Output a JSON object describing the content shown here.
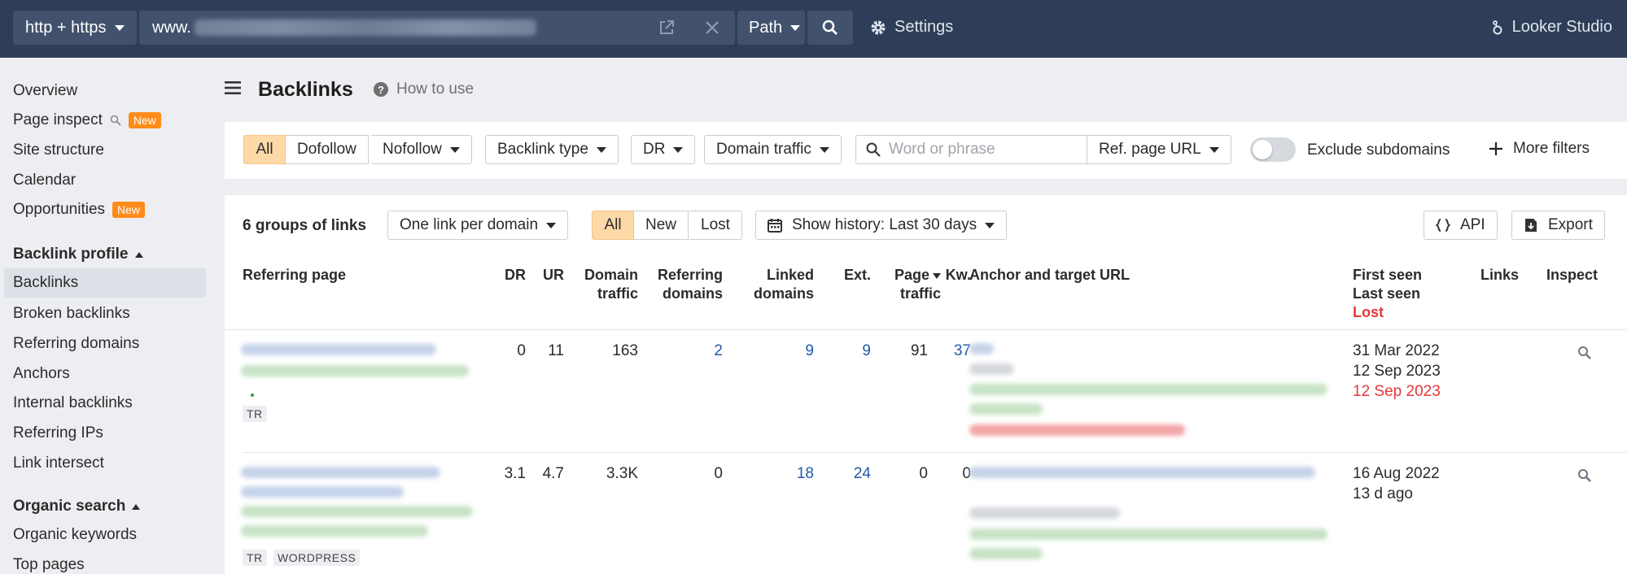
{
  "topbar": {
    "protocol": "http + https",
    "url_prefix": "www.",
    "path_label": "Path",
    "settings_label": "Settings",
    "looker_label": "Looker Studio"
  },
  "sidebar": {
    "items": [
      {
        "label": "Overview"
      },
      {
        "label": "Page inspect",
        "badge": "New"
      },
      {
        "label": "Site structure"
      },
      {
        "label": "Calendar"
      },
      {
        "label": "Opportunities",
        "badge": "New"
      }
    ],
    "backlink_profile": {
      "heading": "Backlink profile",
      "items": [
        "Backlinks",
        "Broken backlinks",
        "Referring domains",
        "Anchors",
        "Internal backlinks",
        "Referring IPs",
        "Link intersect"
      ]
    },
    "organic_search": {
      "heading": "Organic search",
      "items": [
        "Organic keywords",
        "Top pages"
      ]
    }
  },
  "main": {
    "title": "Backlinks",
    "how_to_use": "How to use"
  },
  "filters": {
    "all": "All",
    "dofollow": "Dofollow",
    "nofollow": "Nofollow",
    "backlink_type": "Backlink type",
    "dr": "DR",
    "domain_traffic": "Domain traffic",
    "search_placeholder": "Word or phrase",
    "ref_page_url": "Ref. page URL",
    "exclude_subdomains": "Exclude subdomains",
    "more_filters": "More filters"
  },
  "results": {
    "groups_label": "6 groups of links",
    "grouping": "One link per domain",
    "all": "All",
    "new": "New",
    "lost": "Lost",
    "history": "Show history: Last 30 days",
    "api": "API",
    "export": "Export"
  },
  "table": {
    "headers": {
      "referring_page": "Referring page",
      "dr": "DR",
      "ur": "UR",
      "domain_traffic_1": "Domain",
      "domain_traffic_2": "traffic",
      "referring_domains_1": "Referring",
      "referring_domains_2": "domains",
      "linked_domains_1": "Linked",
      "linked_domains_2": "domains",
      "ext": "Ext.",
      "page_traffic_1": "Page",
      "page_traffic_2": "traffic",
      "kw": "Kw.",
      "anchor": "Anchor and target URL",
      "first_seen": "First seen",
      "last_seen": "Last seen",
      "lost": "Lost",
      "links": "Links",
      "inspect": "Inspect"
    },
    "rows": [
      {
        "dr": "0",
        "ur": "11",
        "domain_traffic": "163",
        "referring_domains": "2",
        "linked_domains": "9",
        "ext": "9",
        "page_traffic": "91",
        "kw": "37",
        "first_seen": "31 Mar 2022",
        "last_seen": "12 Sep 2023",
        "lost": "12 Sep 2023",
        "tags": [
          "TR"
        ]
      },
      {
        "dr": "3.1",
        "ur": "4.7",
        "domain_traffic": "3.3K",
        "referring_domains": "0",
        "linked_domains": "18",
        "ext": "24",
        "page_traffic": "0",
        "kw": "0",
        "first_seen": "16 Aug 2022",
        "last_seen": "13 d ago",
        "tags": [
          "TR",
          "WORDPRESS"
        ]
      }
    ]
  },
  "colors": {
    "topbar_bg": "#2e3e58",
    "active_filter_bg": "#fed9a8",
    "badge_new": "#ff8c1a",
    "link_blue": "#1f5ba8",
    "lost_red": "#e5383b"
  }
}
